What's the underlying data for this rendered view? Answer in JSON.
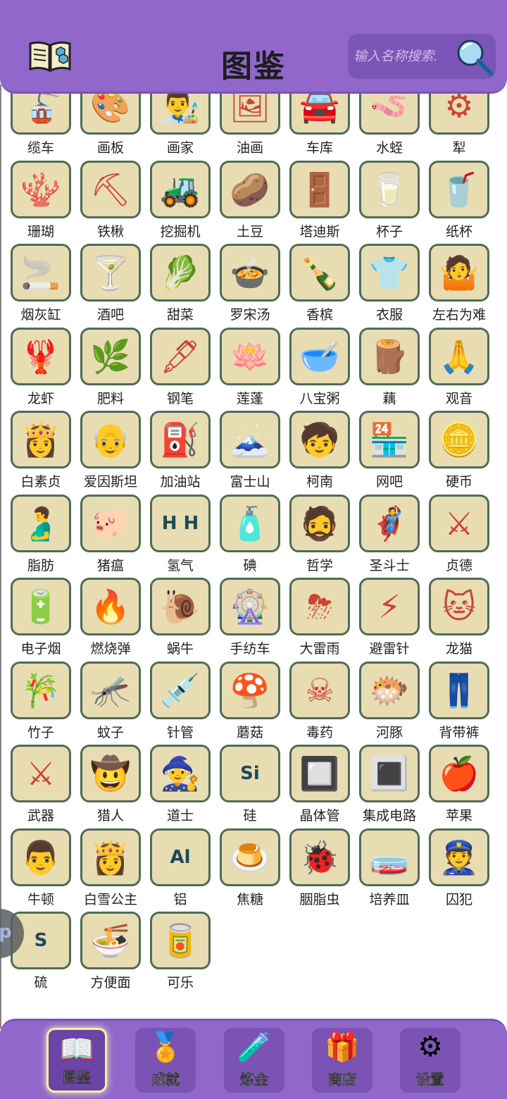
{
  "header": {
    "title": "图鉴",
    "search_placeholder": "输入名称搜索."
  },
  "items": [
    {
      "name": "缆车",
      "icon": "cable-car-icon",
      "glyph": "🚡"
    },
    {
      "name": "画板",
      "icon": "easel-icon",
      "glyph": "🎨"
    },
    {
      "name": "画家",
      "icon": "painter-icon",
      "glyph": "👨‍🎨"
    },
    {
      "name": "油画",
      "icon": "oil-painting-icon",
      "glyph": "🖼"
    },
    {
      "name": "车库",
      "icon": "garage-icon",
      "glyph": "🚘"
    },
    {
      "name": "水蛭",
      "icon": "leech-icon",
      "glyph": "🪱"
    },
    {
      "name": "犁",
      "icon": "plow-icon",
      "glyph": "⚙"
    },
    {
      "name": "珊瑚",
      "icon": "coral-icon",
      "glyph": "🪸"
    },
    {
      "name": "铁楸",
      "icon": "shovel-icon",
      "glyph": "⛏"
    },
    {
      "name": "挖掘机",
      "icon": "excavator-icon",
      "glyph": "🚜"
    },
    {
      "name": "土豆",
      "icon": "potato-icon",
      "glyph": "🥔"
    },
    {
      "name": "塔迪斯",
      "icon": "tardis-icon",
      "glyph": "🚪"
    },
    {
      "name": "杯子",
      "icon": "glass-cup-icon",
      "glyph": "🥛"
    },
    {
      "name": "纸杯",
      "icon": "paper-cup-icon",
      "glyph": "🥤"
    },
    {
      "name": "烟灰缸",
      "icon": "ashtray-icon",
      "glyph": "🚬"
    },
    {
      "name": "酒吧",
      "icon": "bar-icon",
      "glyph": "🍸"
    },
    {
      "name": "甜菜",
      "icon": "beet-icon",
      "glyph": "🥬"
    },
    {
      "name": "罗宋汤",
      "icon": "borscht-icon",
      "glyph": "🍲"
    },
    {
      "name": "香槟",
      "icon": "champagne-icon",
      "glyph": "🍾"
    },
    {
      "name": "衣服",
      "icon": "clothes-icon",
      "glyph": "👕"
    },
    {
      "name": "左右为难",
      "icon": "dilemma-icon",
      "glyph": "🤷"
    },
    {
      "name": "龙虾",
      "icon": "lobster-icon",
      "glyph": "🦞"
    },
    {
      "name": "肥料",
      "icon": "fertilizer-icon",
      "glyph": "🌿"
    },
    {
      "name": "钢笔",
      "icon": "fountain-pen-icon",
      "glyph": "🖋"
    },
    {
      "name": "莲蓬",
      "icon": "lotus-pod-icon",
      "glyph": "🪷"
    },
    {
      "name": "八宝粥",
      "icon": "congee-icon",
      "glyph": "🥣"
    },
    {
      "name": "藕",
      "icon": "lotus-root-icon",
      "glyph": "🪵"
    },
    {
      "name": "观音",
      "icon": "guanyin-icon",
      "glyph": "🙏"
    },
    {
      "name": "白素贞",
      "icon": "bai-suzhen-icon",
      "glyph": "👸"
    },
    {
      "name": "爱因斯坦",
      "icon": "einstein-icon",
      "glyph": "👴"
    },
    {
      "name": "加油站",
      "icon": "gas-station-icon",
      "glyph": "⛽"
    },
    {
      "name": "富士山",
      "icon": "mount-fuji-icon",
      "glyph": "🗻"
    },
    {
      "name": "柯南",
      "icon": "conan-icon",
      "glyph": "🧒"
    },
    {
      "name": "网吧",
      "icon": "internet-cafe-icon",
      "glyph": "🏪"
    },
    {
      "name": "硬币",
      "icon": "coin-icon",
      "glyph": "🪙"
    },
    {
      "name": "脂肪",
      "icon": "fat-icon",
      "glyph": "🫃"
    },
    {
      "name": "猪瘟",
      "icon": "swine-fever-icon",
      "glyph": "🐖"
    },
    {
      "name": "氢气",
      "icon": "hydrogen-icon",
      "glyph": "H H"
    },
    {
      "name": "碘",
      "icon": "iodine-icon",
      "glyph": "🧴"
    },
    {
      "name": "哲学",
      "icon": "philosophy-icon",
      "glyph": "🧔"
    },
    {
      "name": "圣斗士",
      "icon": "saint-seiya-icon",
      "glyph": "🦸"
    },
    {
      "name": "贞德",
      "icon": "joan-of-arc-icon",
      "glyph": "⚔"
    },
    {
      "name": "电子烟",
      "icon": "e-cigarette-icon",
      "glyph": "🔋"
    },
    {
      "name": "燃烧弹",
      "icon": "molotov-icon",
      "glyph": "🔥"
    },
    {
      "name": "蜗牛",
      "icon": "snail-icon",
      "glyph": "🐌"
    },
    {
      "name": "手纺车",
      "icon": "spinning-wheel-icon",
      "glyph": "🎡"
    },
    {
      "name": "大雷雨",
      "icon": "thunderstorm-icon",
      "glyph": "⛈"
    },
    {
      "name": "避雷针",
      "icon": "lightning-rod-icon",
      "glyph": "⚡"
    },
    {
      "name": "龙猫",
      "icon": "totoro-icon",
      "glyph": "🐱"
    },
    {
      "name": "竹子",
      "icon": "bamboo-icon",
      "glyph": "🎋"
    },
    {
      "name": "蚊子",
      "icon": "mosquito-icon",
      "glyph": "🦟"
    },
    {
      "name": "针管",
      "icon": "syringe-icon",
      "glyph": "💉"
    },
    {
      "name": "蘑菇",
      "icon": "mushroom-icon",
      "glyph": "🍄"
    },
    {
      "name": "毒药",
      "icon": "poison-icon",
      "glyph": "☠"
    },
    {
      "name": "河豚",
      "icon": "pufferfish-icon",
      "glyph": "🐡"
    },
    {
      "name": "背带裤",
      "icon": "overalls-icon",
      "glyph": "👖"
    },
    {
      "name": "武器",
      "icon": "weapon-icon",
      "glyph": "⚔"
    },
    {
      "name": "猎人",
      "icon": "hunter-icon",
      "glyph": "🤠"
    },
    {
      "name": "道士",
      "icon": "taoist-icon",
      "glyph": "🧙"
    },
    {
      "name": "硅",
      "icon": "silicon-icon",
      "glyph": "Si"
    },
    {
      "name": "晶体管",
      "icon": "transistor-icon",
      "glyph": "🔲"
    },
    {
      "name": "集成电路",
      "icon": "chip-icon",
      "glyph": "🔳"
    },
    {
      "name": "苹果",
      "icon": "apple-icon",
      "glyph": "🍎"
    },
    {
      "name": "牛顿",
      "icon": "newton-icon",
      "glyph": "👨"
    },
    {
      "name": "白雪公主",
      "icon": "snow-white-icon",
      "glyph": "👸"
    },
    {
      "name": "铝",
      "icon": "aluminium-icon",
      "glyph": "Al"
    },
    {
      "name": "焦糖",
      "icon": "caramel-icon",
      "glyph": "🍮"
    },
    {
      "name": "胭脂虫",
      "icon": "cochineal-icon",
      "glyph": "🐞"
    },
    {
      "name": "培养皿",
      "icon": "petri-dish-icon",
      "glyph": "🧫"
    },
    {
      "name": "囚犯",
      "icon": "prisoner-icon",
      "glyph": "👮"
    },
    {
      "name": "硫",
      "icon": "sulfur-icon",
      "glyph": "S"
    },
    {
      "name": "方便面",
      "icon": "instant-noodles-icon",
      "glyph": "🍜"
    },
    {
      "name": "可乐",
      "icon": "cola-icon",
      "glyph": "🥫"
    }
  ],
  "nav": [
    {
      "label": "图鉴",
      "icon": "book-icon",
      "glyph": "📖",
      "active": true
    },
    {
      "label": "成就",
      "icon": "medal-icon",
      "glyph": "🏅",
      "active": false
    },
    {
      "label": "炼金",
      "icon": "flask-icon",
      "glyph": "🧪",
      "active": false
    },
    {
      "label": "商店",
      "icon": "gift-icon",
      "glyph": "🎁",
      "active": false
    },
    {
      "label": "设置",
      "icon": "gear-icon",
      "glyph": "⚙",
      "active": false
    }
  ],
  "side_tab": {
    "label": "p"
  },
  "colors": {
    "header": "#9167cc",
    "tile_bg": "#e8dcb3",
    "tile_border": "#4f6b55",
    "active_glow": "#f6f0a6"
  }
}
